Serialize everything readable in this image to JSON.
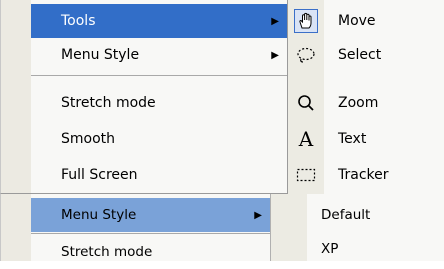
{
  "main_menu": {
    "items": [
      {
        "label": "Tools",
        "has_submenu": true,
        "highlighted": true
      },
      {
        "label": "Menu Style",
        "has_submenu": true,
        "highlighted": false
      },
      {
        "label": "Stretch mode",
        "has_submenu": false,
        "highlighted": false
      },
      {
        "label": "Smooth",
        "has_submenu": false,
        "highlighted": false
      },
      {
        "label": "Full Screen",
        "has_submenu": false,
        "highlighted": false
      }
    ]
  },
  "tools_submenu": {
    "items": [
      {
        "label": "Move",
        "icon": "hand-icon",
        "selected": true
      },
      {
        "label": "Select",
        "icon": "lasso-select-icon",
        "selected": false
      },
      {
        "label": "Zoom",
        "icon": "magnifier-icon",
        "selected": false
      },
      {
        "label": "Text",
        "icon": "text-A-icon",
        "selected": false
      },
      {
        "label": "Tracker",
        "icon": "dashed-rectangle-icon",
        "selected": false
      }
    ]
  },
  "bottom_menu": {
    "items": [
      {
        "label": "Menu Style",
        "has_submenu": true,
        "highlighted": true
      },
      {
        "label": "Stretch mode",
        "has_submenu": false,
        "highlighted": false
      }
    ]
  },
  "style_submenu": {
    "items": [
      {
        "label": "Default"
      },
      {
        "label": "XP"
      }
    ]
  },
  "colors": {
    "highlight": "#326ec8",
    "highlight_light": "#7aa2d8",
    "menu_bg": "#f8f8f6",
    "gutter": "#eceae2"
  }
}
